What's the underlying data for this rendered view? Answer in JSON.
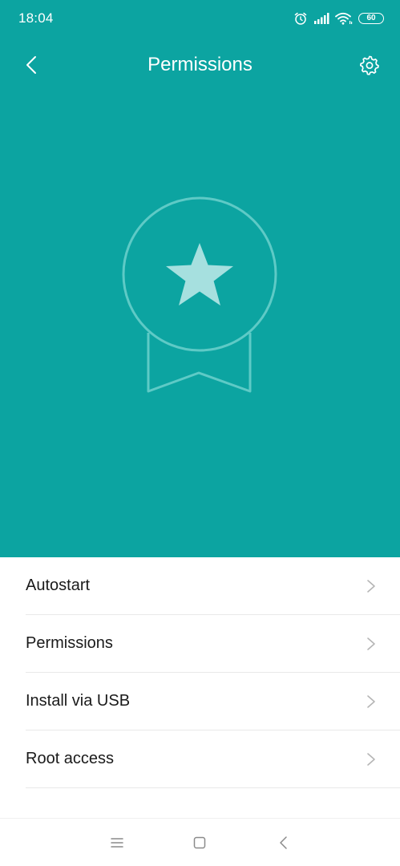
{
  "status_bar": {
    "time": "18:04",
    "battery_level": "60",
    "icons": [
      "alarm-icon",
      "signal-icon",
      "wifi-icon",
      "battery-icon"
    ]
  },
  "app_bar": {
    "title": "Permissions",
    "back_icon": "chevron-left-icon",
    "settings_icon": "gear-icon"
  },
  "hero": {
    "illustration": "star-medal-icon"
  },
  "menu": {
    "items": [
      {
        "label": "Autostart"
      },
      {
        "label": "Permissions"
      },
      {
        "label": "Install via USB"
      },
      {
        "label": "Root access"
      }
    ]
  },
  "nav_bar": {
    "buttons": [
      "menu-icon",
      "home-icon",
      "back-icon"
    ]
  },
  "colors": {
    "hero_background": "#0ca4a1",
    "star_fill": "#a6e0df",
    "badge_outline": "#5ecac6",
    "text_primary": "#1a1a1a",
    "chevron": "#b5b5b5",
    "divider": "#e9e9e9"
  }
}
